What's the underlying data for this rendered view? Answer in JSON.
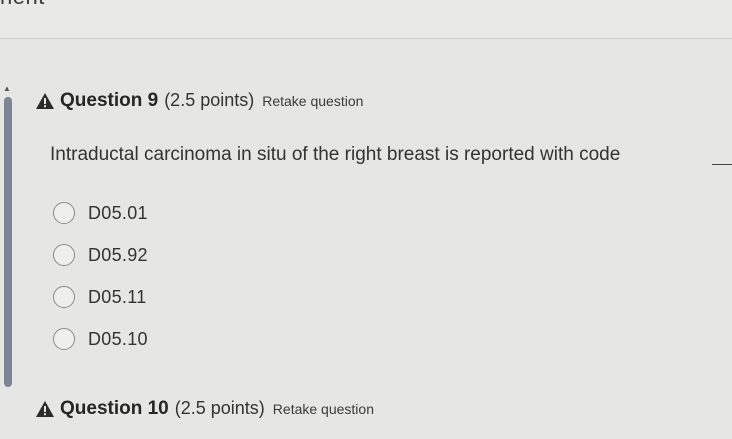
{
  "header": {
    "partial_title": "nent"
  },
  "questions": [
    {
      "title": "Question 9",
      "points": "(2.5 points)",
      "retake": "Retake question",
      "prompt": "Intraductal carcinoma in situ of the right breast is reported with code",
      "options": [
        "D05.01",
        "D05.92",
        "D05.11",
        "D05.10"
      ]
    },
    {
      "title": "Question 10",
      "points": "(2.5 points)",
      "retake": "Retake question"
    }
  ],
  "colors": {
    "background": "#e6e6e4",
    "rail": "#7c8596",
    "warning": "#2b2b2b"
  },
  "icons": {
    "warning": "warning-triangle-icon",
    "radio": "radio-circle"
  }
}
